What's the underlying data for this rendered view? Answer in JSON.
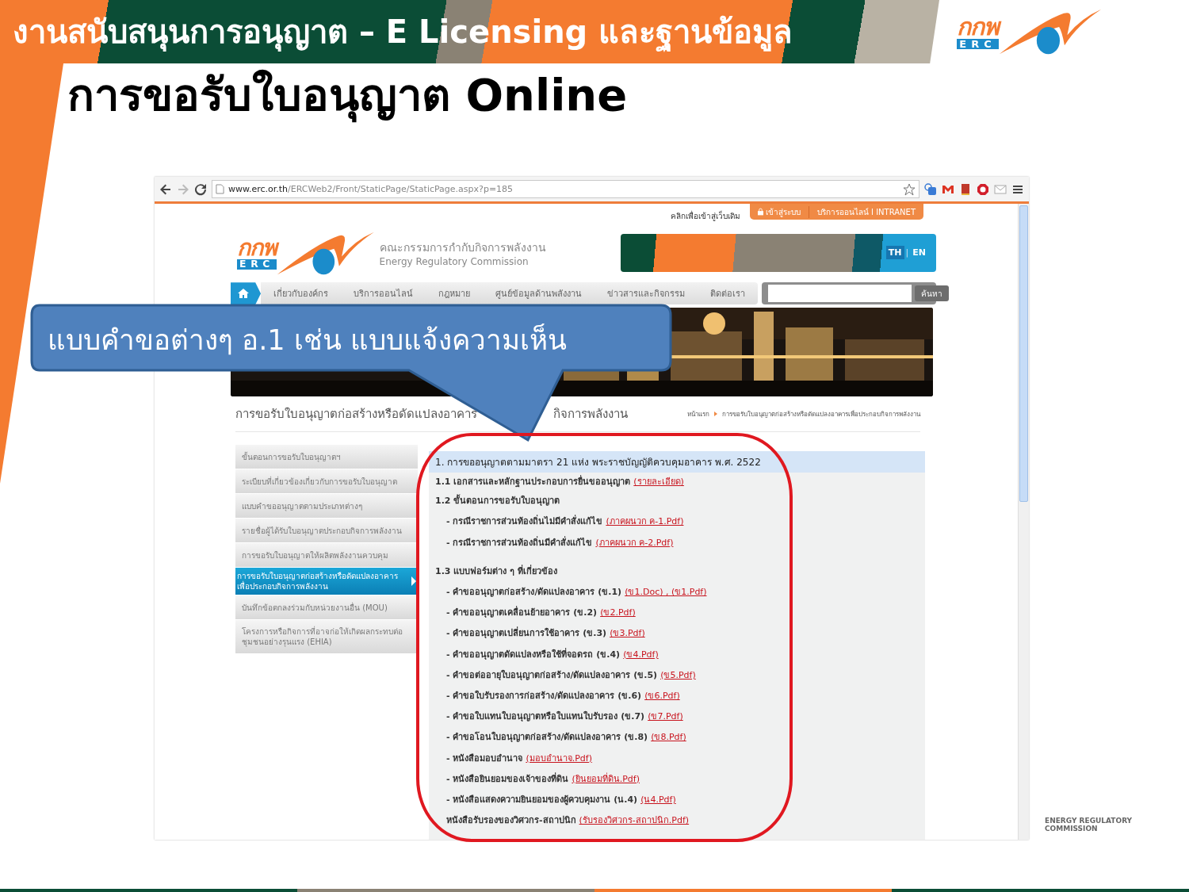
{
  "slide": {
    "banner_title": "งานสนับสนุนการอนุญาต – E Licensing และฐานข้อมูล",
    "title": "การขอรับใบอนุญาต Online",
    "logo": {
      "mark": "กกพ",
      "text": "ERC"
    },
    "footer": "ENERGY REGULATORY COMMISSION"
  },
  "browser": {
    "url_host": "www.erc.or.th",
    "url_path": "/ERCWeb2/Front/StaticPage/StaticPage.aspx?p=185"
  },
  "site": {
    "top_link": "คลิกเพื่อเข้าสู่เว็บเดิม",
    "login": "เข้าสู่ระบบ",
    "online_services": "บริการออนไลน์ I INTRANET",
    "logo": {
      "mark": "กกพ",
      "text": "ERC"
    },
    "org_name_th": "คณะกรรมการกำกับกิจการพลังงาน",
    "org_name_en": "Energy Regulatory Commission",
    "languages": [
      {
        "label": "TH",
        "selected": true
      },
      {
        "label": "EN",
        "selected": false
      }
    ],
    "language_separator": "|",
    "nav": [
      "เกี่ยวกับองค์กร",
      "บริการออนไลน์",
      "กฎหมาย",
      "ศูนย์ข้อมูลด้านพลังงาน",
      "ข่าวสารและกิจกรรม",
      "ติดต่อเรา"
    ],
    "search_button": "ค้นหา",
    "page_heading_parts": [
      "การขอรับใบอนุญาตก่อสร้างหรือดัดแปลงอาคาร",
      "กิจการพลังงาน"
    ],
    "breadcrumb": [
      "หน้าแรก",
      "การขอรับใบอนุญาตก่อสร้างหรือดัดแปลงอาคารเพื่อประกอบกิจการพลังงาน"
    ],
    "side_menu": [
      {
        "label": "ขั้นตอนการขอรับใบอนุญาตฯ",
        "selected": false
      },
      {
        "label": "ระเบียบที่เกี่ยวข้องเกี่ยวกับการขอรับใบอนุญาต",
        "selected": false
      },
      {
        "label": "แบบคำขออนุญาตตามประเภทต่างๆ",
        "selected": false
      },
      {
        "label": "รายชื่อผู้ได้รับใบอนุญาตประกอบกิจการพลังงาน",
        "selected": false
      },
      {
        "label": "การขอรับใบอนุญาตให้ผลิตพลังงานควบคุม",
        "selected": false
      },
      {
        "label": "การขอรับใบอนุญาตก่อสร้างหรือดัดแปลงอาคารเพื่อประกอบกิจการพลังงาน",
        "selected": true
      },
      {
        "label": "บันทึกข้อตกลงร่วมกับหน่วยงานอื่น (MOU)",
        "selected": false
      },
      {
        "label": "โครงการหรือกิจการที่อาจก่อให้เกิดผลกระทบต่อชุมชนอย่างรุนแรง (EHIA)",
        "selected": false
      }
    ],
    "content": {
      "header": "1. การขออนุญาตตามมาตรา 21 แห่ง พระราชบัญญัติควบคุมอาคาร พ.ศ. 2522",
      "rows": [
        {
          "kind": "heading",
          "text": "1.1 เอกสารและหลักฐานประกอบการยื่นขออนุญาต",
          "link": "(รายละเอียด)"
        },
        {
          "kind": "heading",
          "text": "1.2 ขั้นตอนการขอรับใบอนุญาต"
        },
        {
          "kind": "item",
          "text": "- กรณีราชการส่วนท้องถิ่นไม่มีคำสั่งแก้ไข",
          "link": "(ภาคผนวก ค-1.Pdf)"
        },
        {
          "kind": "item",
          "text": "- กรณีราชการส่วนท้องถิ่นมีคำสั่งแก้ไข",
          "link": "(ภาคผนวก ค-2.Pdf)"
        },
        {
          "kind": "section",
          "text": "1.3 แบบฟอร์มต่าง ๆ ที่เกี่ยวข้อง"
        },
        {
          "kind": "item",
          "text": "- คำขออนุญาตก่อสร้าง/ดัดแปลงอาคาร (ข.1)",
          "link": "(ข1.Doc) , (ข1.Pdf)"
        },
        {
          "kind": "item",
          "text": "- คำขออนุญาตเคลื่อนย้ายอาคาร (ข.2)",
          "link": "(ข2.Pdf)"
        },
        {
          "kind": "item",
          "text": "- คำขออนุญาตเปลี่ยนการใช้อาคาร (ข.3)",
          "link": "(ข3.Pdf)"
        },
        {
          "kind": "item",
          "text": "- คำขออนุญาตดัดแปลงหรือใช้ที่จอดรถ (ข.4)",
          "link": "(ข4.Pdf)"
        },
        {
          "kind": "item",
          "text": "- คำขอต่ออายุใบอนุญาตก่อสร้าง/ดัดแปลงอาคาร (ข.5)",
          "link": "(ข5.Pdf)"
        },
        {
          "kind": "item",
          "text": "- คำขอใบรับรองการก่อสร้าง/ดัดแปลงอาคาร (ข.6)",
          "link": "(ข6.Pdf)"
        },
        {
          "kind": "item",
          "text": "- คำขอใบแทนใบอนุญาตหรือใบแทนใบรับรอง (ข.7)",
          "link": "(ข7.Pdf)"
        },
        {
          "kind": "item",
          "text": "- คำขอโอนใบอนุญาตก่อสร้าง/ดัดแปลงอาคาร (ข.8)",
          "link": "(ข8.Pdf)"
        },
        {
          "kind": "item",
          "text": "- หนังสือมอบอำนาจ",
          "link": "(มอบอำนาจ.Pdf)"
        },
        {
          "kind": "item",
          "text": "- หนังสือยินยอมของเจ้าของที่ดิน",
          "link": "(ยินยอมที่ดิน.Pdf)"
        },
        {
          "kind": "item",
          "text": "- หนังสือแสดงความยินยอมของผู้ควบคุมงาน (น.4)",
          "link": "(น4.Pdf)"
        },
        {
          "kind": "item",
          "text": "หนังสือรับรองของวิศวกร-สถาปนิก",
          "link": "(รับรองวิศวกร-สถาปนิก.Pdf)"
        }
      ]
    }
  },
  "callout": {
    "text": "แบบคำขอต่างๆ อ.1 เช่น แบบแจ้งความเห็น"
  }
}
